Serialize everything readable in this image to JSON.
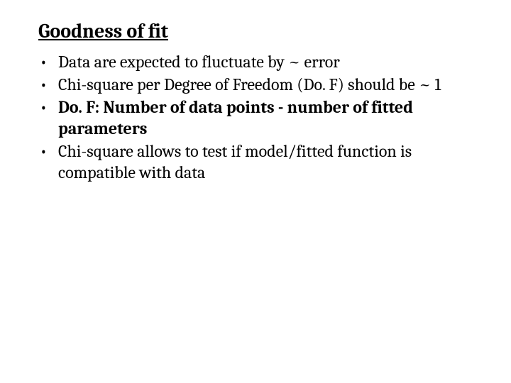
{
  "title": "Goodness of fit",
  "bullets": [
    {
      "text": "Data are expected  to fluctuate by ~ error",
      "bold": false
    },
    {
      "text": "Chi-square per Degree of Freedom (Do. F) should be ~ 1",
      "bold": false
    },
    {
      "text": "Do. F: Number of data points - number of fitted parameters",
      "bold": true
    },
    {
      "text": "Chi-square allows  to test if model/fitted function is compatible with data",
      "bold": false
    }
  ]
}
